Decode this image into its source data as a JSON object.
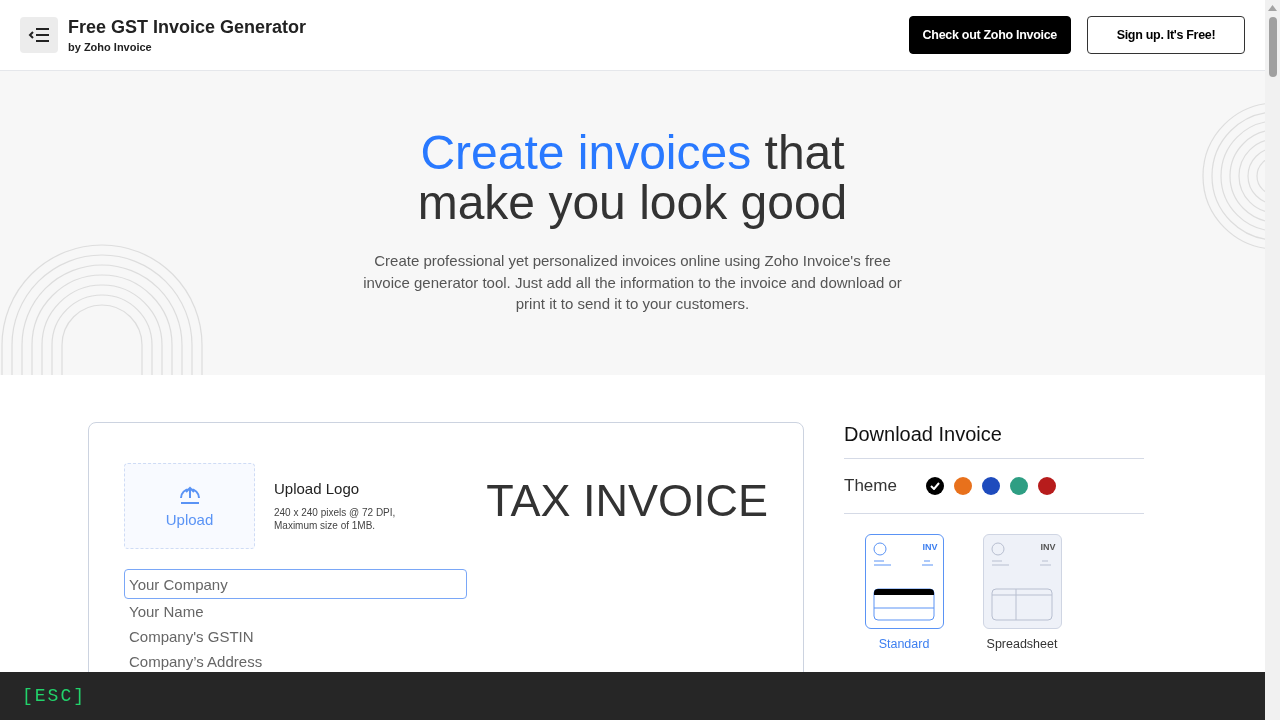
{
  "header": {
    "title": "Free GST Invoice Generator",
    "subtitle": "by Zoho Invoice",
    "buttons": [
      {
        "label": "Check out Zoho Invoice",
        "kind": "primary"
      },
      {
        "label": "Sign up. It's Free!",
        "kind": "outline"
      }
    ]
  },
  "hero": {
    "heading": "Create invoices",
    "heading_rest": "that",
    "heading_line2": "make you look good",
    "description": "Create professional yet personalized invoices online using Zoho Invoice's free invoice generator tool. Just add all the information to the invoice and download or print it to send it to your customers."
  },
  "invoice": {
    "upload_label": "Upload",
    "logo_title": "Upload Logo",
    "logo_hint": "240 x 240 pixels @ 72 DPI,\nMaximum size of 1MB.",
    "title": "TAX INVOICE",
    "fields": [
      {
        "placeholder": "Your Company",
        "focused": true
      },
      {
        "placeholder": "Your Name",
        "focused": false
      },
      {
        "placeholder": "Company's GSTIN",
        "focused": false
      },
      {
        "placeholder": "Company’s Address",
        "focused": false
      }
    ]
  },
  "download": {
    "title": "Download Invoice",
    "theme_label": "Theme",
    "themes": [
      {
        "color": "#000000",
        "selected": true
      },
      {
        "color": "#e8711c",
        "selected": false
      },
      {
        "color": "#1e4bbd",
        "selected": false
      },
      {
        "color": "#2e9e83",
        "selected": false
      },
      {
        "color": "#b71c1c",
        "selected": false
      }
    ],
    "templates": [
      {
        "label": "Standard",
        "tag": "INV",
        "kind": "standard",
        "selected": true
      },
      {
        "label": "Spreadsheet",
        "tag": "INV",
        "kind": "spreadsheet",
        "selected": false
      }
    ]
  },
  "overlay": {
    "key": "[ESC]"
  }
}
